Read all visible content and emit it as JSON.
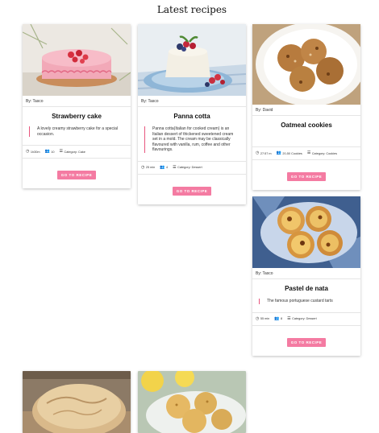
{
  "page": {
    "title": "Latest recipes"
  },
  "recipes": [
    {
      "author": "By: Tasco",
      "title": "Strawberry cake",
      "description": "A lovely creamy strawberry cake for a special occasion.",
      "time": "1h30m",
      "servings": "10",
      "category": "Category: Cake",
      "button": "GO TO RECIPE",
      "image": "strawberry-cake-photo"
    },
    {
      "author": "By: Tasco",
      "title": "Panna cotta",
      "description": "Panna cotta(Italian for cooked cream) is an Italian dessert of thickened sweetened cream set in a mold. The cream may be classically flavoured with vanilla, rum, coffee and other flavourings.",
      "time": "25 min",
      "servings": "4",
      "category": "Category: Dessert",
      "button": "GO TO RECIPE",
      "image": "panna-cotta-photo"
    },
    {
      "author": "By: David",
      "title": "Oatmeal cookies",
      "description": "",
      "time": "27:57 m",
      "servings": "20-50 Cookies",
      "category": "Category: Cookies",
      "button": "GO TO RECIPE",
      "image": "oatmeal-cookies-photo"
    },
    {
      "author": "By: Tasco",
      "title": "Pastel de nata",
      "description": "The famous portuguese custard tarts",
      "time": "55 min",
      "servings": "8",
      "category": "Category: Dessert",
      "button": "GO TO RECIPE",
      "image": "pastel-de-nata-photo"
    },
    {
      "image": "bread-photo"
    },
    {
      "image": "lemon-cookies-photo"
    }
  ],
  "icons": {
    "time": "clock-icon",
    "servings": "people-icon",
    "category": "list-icon"
  },
  "colors": {
    "accent": "#f47ba2",
    "quote_border": "#e8567e"
  }
}
